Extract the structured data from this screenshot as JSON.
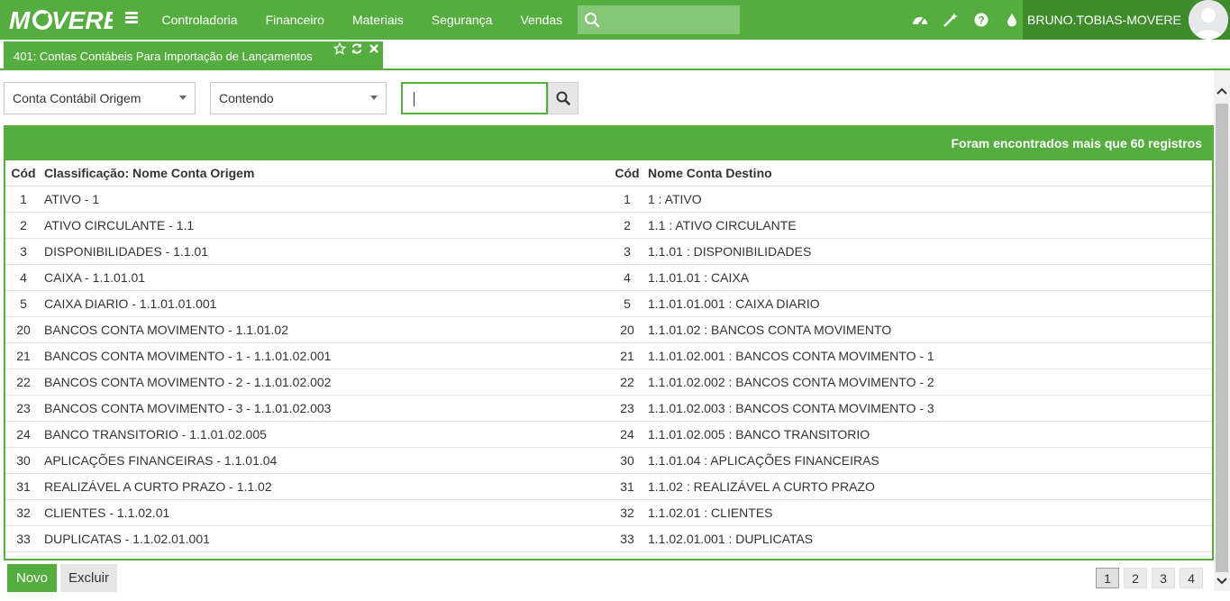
{
  "app": {
    "logo_text": "MOVERE"
  },
  "nav": {
    "menu": [
      "Controladoria",
      "Financeiro",
      "Materiais",
      "Segurança",
      "Vendas"
    ],
    "search_value": "",
    "user_name": "BRUNO.TOBIAS-MOVERE",
    "icons": [
      "dashboard-icon",
      "magic-wand-icon",
      "help-icon",
      "drop-icon"
    ]
  },
  "tab": {
    "title": "401: Contas Contábeis Para Importação de Lançamentos"
  },
  "filters": {
    "field": "Conta Contábil Origem",
    "operator": "Contendo",
    "value": ""
  },
  "table": {
    "summary": "Foram encontrados mais que 60 registros",
    "headers": [
      "Cód",
      "Classificação: Nome Conta Origem",
      "Cód",
      "Nome Conta Destino"
    ],
    "rows": [
      [
        "1",
        "ATIVO - 1",
        "1",
        "1 : ATIVO"
      ],
      [
        "2",
        "ATIVO CIRCULANTE - 1.1",
        "2",
        "1.1 : ATIVO CIRCULANTE"
      ],
      [
        "3",
        "DISPONIBILIDADES - 1.1.01",
        "3",
        "1.1.01 : DISPONIBILIDADES"
      ],
      [
        "4",
        "CAIXA - 1.1.01.01",
        "4",
        "1.1.01.01 : CAIXA"
      ],
      [
        "5",
        "CAIXA DIARIO - 1.1.01.01.001",
        "5",
        "1.1.01.01.001 : CAIXA DIARIO"
      ],
      [
        "20",
        "BANCOS CONTA MOVIMENTO - 1.1.01.02",
        "20",
        "1.1.01.02 : BANCOS CONTA MOVIMENTO"
      ],
      [
        "21",
        "BANCOS CONTA MOVIMENTO - 1 - 1.1.01.02.001",
        "21",
        "1.1.01.02.001 : BANCOS CONTA MOVIMENTO - 1"
      ],
      [
        "22",
        "BANCOS CONTA MOVIMENTO - 2 - 1.1.01.02.002",
        "22",
        "1.1.01.02.002 : BANCOS CONTA MOVIMENTO - 2"
      ],
      [
        "23",
        "BANCOS CONTA MOVIMENTO - 3 - 1.1.01.02.003",
        "23",
        "1.1.01.02.003 : BANCOS CONTA MOVIMENTO - 3"
      ],
      [
        "24",
        "BANCO TRANSITORIO - 1.1.01.02.005",
        "24",
        "1.1.01.02.005 : BANCO TRANSITORIO"
      ],
      [
        "30",
        "APLICAÇÕES FINANCEIRAS - 1.1.01.04",
        "30",
        "1.1.01.04 : APLICAÇÕES FINANCEIRAS"
      ],
      [
        "31",
        "REALIZÁVEL A CURTO PRAZO - 1.1.02",
        "31",
        "1.1.02 : REALIZÁVEL A CURTO PRAZO"
      ],
      [
        "32",
        "CLIENTES - 1.1.02.01",
        "32",
        "1.1.02.01 : CLIENTES"
      ],
      [
        "33",
        "DUPLICATAS - 1.1.02.01.001",
        "33",
        "1.1.02.01.001 : DUPLICATAS"
      ]
    ]
  },
  "footer": {
    "new_label": "Novo",
    "delete_label": "Excluir",
    "pages": [
      "1",
      "2",
      "3",
      "4"
    ],
    "current_page": "1"
  },
  "colors": {
    "brand_green": "#55ac3f",
    "dark_green": "#3f8c2d",
    "search_green": "#85c776"
  }
}
